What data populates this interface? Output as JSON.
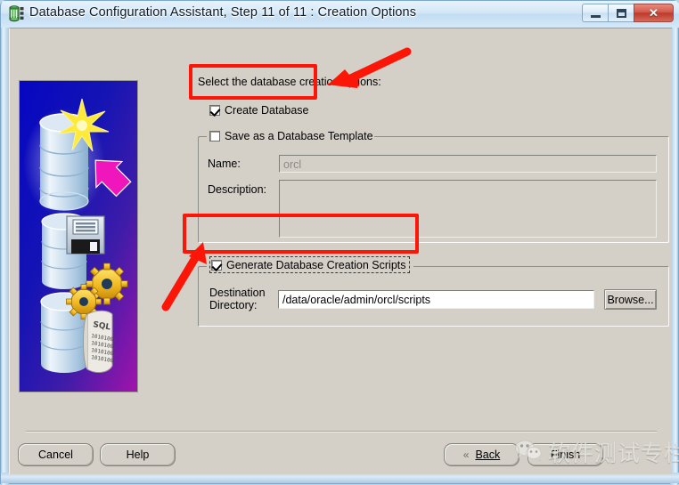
{
  "window": {
    "title": "Database Configuration Assistant, Step 11 of 11 : Creation Options",
    "icon": "database-cylinder-icon",
    "minimize_label": "Minimize",
    "maximize_label": "Maximize",
    "close_label": "✕"
  },
  "banner": {
    "alt": "oracle-database-creation-banner"
  },
  "main": {
    "instruction": "Select the database creation options:",
    "create_database": {
      "label": "Create Database",
      "checked": true
    },
    "save_template_group": {
      "label": "Save as a Database Template",
      "checked": false,
      "name_label": "Name:",
      "name_value": "orcl",
      "description_label": "Description:",
      "description_value": ""
    },
    "generate_scripts_group": {
      "label": "Generate Database Creation Scripts",
      "checked": true,
      "destination_label_line1": "Destination",
      "destination_label_line2": "Directory:",
      "destination_value": "/data/oracle/admin/orcl/scripts",
      "browse_label": "Browse..."
    }
  },
  "footer": {
    "cancel_label": "Cancel",
    "help_label": "Help",
    "back_label": "Back",
    "back_chevron": "«",
    "finish_label": "Finish"
  },
  "watermark": {
    "text": "软件测试专栏",
    "logo": "wechat-logo"
  },
  "annotations": {
    "highlight_create_database": "red-box-create-database",
    "highlight_generate_scripts": "red-box-generate-scripts",
    "arrow_top": "red-arrow-pointing-to-create-database",
    "arrow_bottom": "red-arrow-pointing-to-generate-scripts"
  },
  "colors": {
    "annotation_red": "#fb1607",
    "dialog_gray": "#d4d0c8",
    "banner_blue": "#0a0ac4",
    "banner_magenta": "#e817b6"
  }
}
